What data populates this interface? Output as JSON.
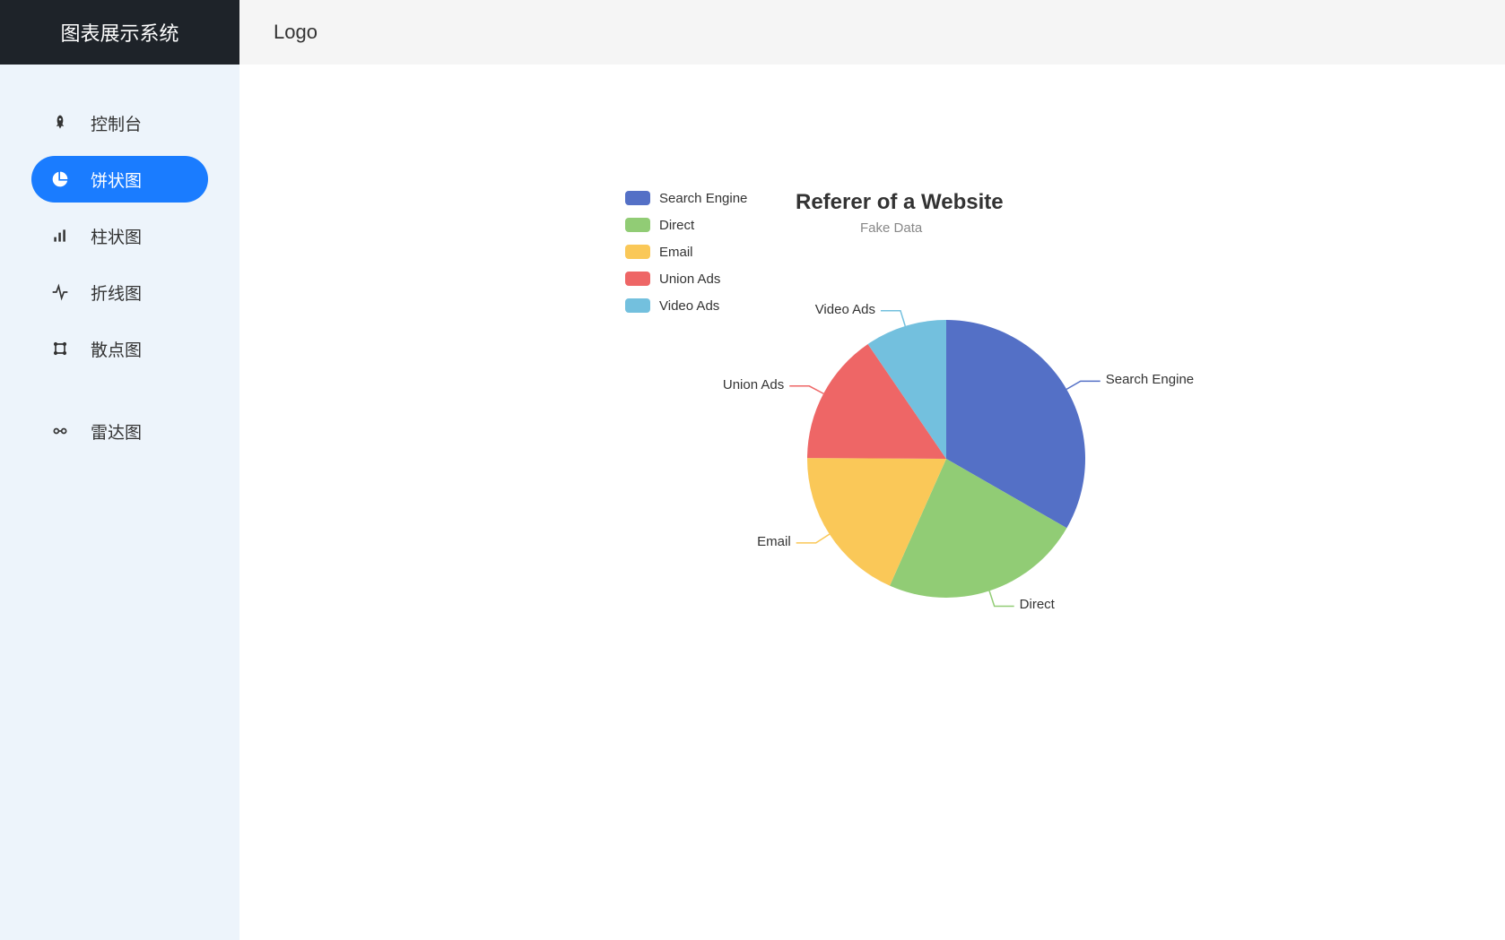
{
  "header": {
    "app_title": "图表展示系统",
    "logo_text": "Logo"
  },
  "sidebar": {
    "items": [
      {
        "label": "控制台",
        "icon": "rocket",
        "active": false
      },
      {
        "label": "饼状图",
        "icon": "pie",
        "active": true
      },
      {
        "label": "柱状图",
        "icon": "bars",
        "active": false
      },
      {
        "label": "折线图",
        "icon": "activity",
        "active": false
      },
      {
        "label": "散点图",
        "icon": "grid",
        "active": false
      },
      {
        "label": "雷达图",
        "icon": "glasses",
        "active": false
      }
    ]
  },
  "chart_data": {
    "type": "pie",
    "title": "Referer of a Website",
    "subtitle": "Fake Data",
    "series": [
      {
        "name": "Search Engine",
        "value": 1048,
        "color": "#5470c6"
      },
      {
        "name": "Direct",
        "value": 735,
        "color": "#91cc75"
      },
      {
        "name": "Email",
        "value": 580,
        "color": "#fac858"
      },
      {
        "name": "Union Ads",
        "value": 484,
        "color": "#ee6666"
      },
      {
        "name": "Video Ads",
        "value": 300,
        "color": "#73c0de"
      }
    ],
    "legend_position": "top-left",
    "label_lines": true
  }
}
